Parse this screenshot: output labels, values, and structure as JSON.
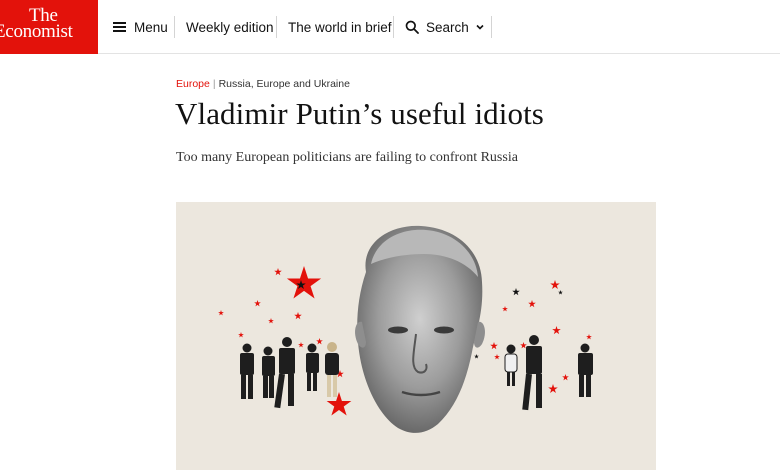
{
  "header": {
    "logo_line1": "The",
    "logo_line2": "Economist",
    "nav": {
      "menu_label": "Menu",
      "weekly_label": "Weekly edition",
      "brief_label": "The world in brief",
      "search_label": "Search"
    }
  },
  "article": {
    "section": "Europe",
    "subsection": "Russia, Europe and Ukraine",
    "headline": "Vladimir Putin’s useful idiots",
    "subheadline": "Too many European politicians are failing to confront Russia"
  },
  "colors": {
    "brand_red": "#e3120b",
    "image_background": "#ece7de"
  },
  "icons": {
    "menu": "hamburger-icon",
    "search": "magnifier-icon",
    "search_toggle": "chevron-down-icon",
    "image_motif": "red-star-icon"
  }
}
